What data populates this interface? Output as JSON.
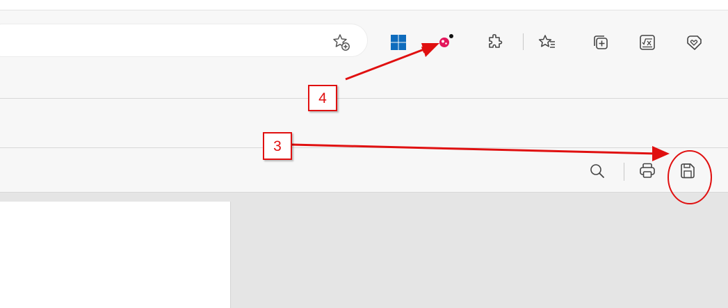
{
  "toolbar": {
    "icons": [
      {
        "name": "add-favorite-icon"
      },
      {
        "name": "windows-widget-icon"
      },
      {
        "name": "extension-badge-icon"
      },
      {
        "name": "extensions-icon"
      },
      {
        "name": "favorites-icon"
      },
      {
        "name": "collections-icon"
      },
      {
        "name": "math-solver-icon"
      },
      {
        "name": "browser-essentials-icon"
      }
    ]
  },
  "pdf_toolbar": {
    "icons": [
      {
        "name": "search-icon"
      },
      {
        "name": "print-icon"
      },
      {
        "name": "save-icon"
      }
    ]
  },
  "annotations": {
    "label_4": "4",
    "label_3": "3",
    "color": "#e01010"
  },
  "colors": {
    "toolbar_bg": "#f7f7f7",
    "content_bg": "#e5e5e5",
    "windows_blue": "#0f6cbd",
    "badge_pink": "#e3165b"
  }
}
